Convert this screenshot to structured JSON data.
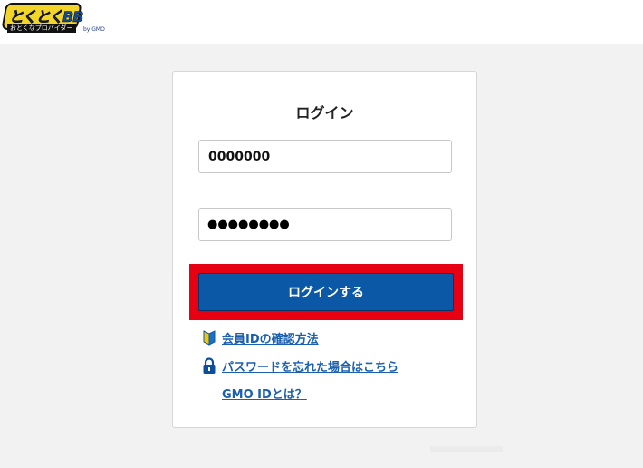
{
  "header": {
    "logo_main": "とくとくBB",
    "logo_sub": "おとくなプロバイダー",
    "logo_by": "by GMO"
  },
  "login": {
    "title": "ログイン",
    "member_id_value": "0000000",
    "password_masked": "●●●●●●●●",
    "submit_label": "ログインする",
    "highlight_color": "#e60012",
    "button_color": "#0b58a6"
  },
  "links": [
    {
      "label": "会員IDの確認方法",
      "icon": "beginner-mark-icon"
    },
    {
      "label": "パスワードを忘れた場合はこちら",
      "icon": "lock-icon"
    },
    {
      "label": "GMO IDとは？",
      "icon": ""
    }
  ]
}
